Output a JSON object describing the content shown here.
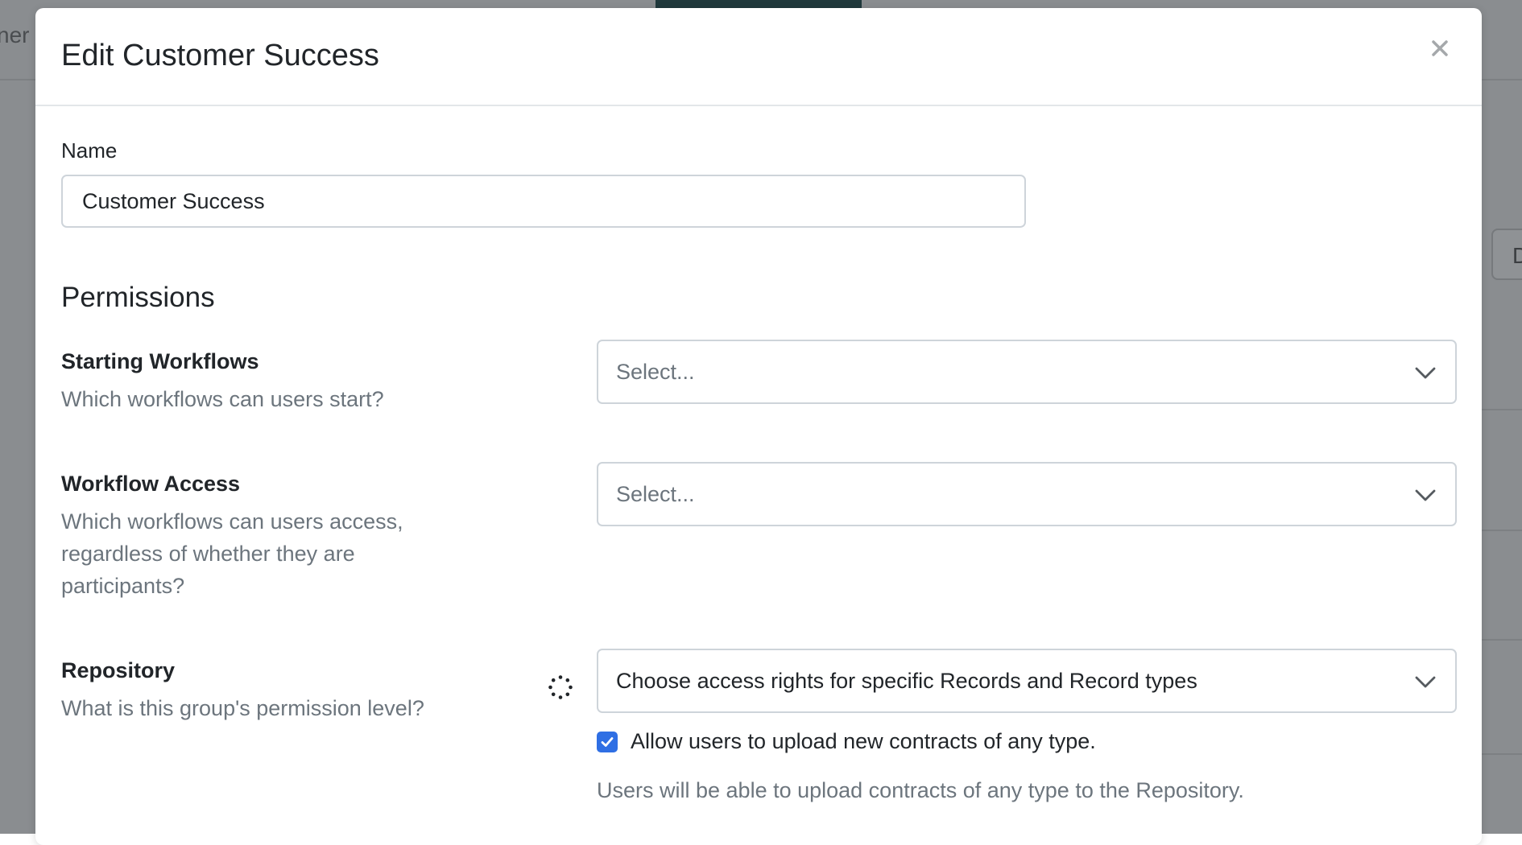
{
  "background": {
    "tab_fragment": "ner",
    "button_fragment": "D"
  },
  "modal": {
    "title": "Edit Customer Success",
    "close_icon": "close-icon"
  },
  "form": {
    "name_label": "Name",
    "name_value": "Customer Success"
  },
  "permissions": {
    "heading": "Permissions",
    "starting_workflows": {
      "label": "Starting Workflows",
      "description": "Which workflows can users start?",
      "select_placeholder": "Select..."
    },
    "workflow_access": {
      "label": "Workflow Access",
      "description": "Which workflows can users access, regardless of whether they are participants?",
      "select_placeholder": "Select..."
    },
    "repository": {
      "label": "Repository",
      "description": "What is this group's permission level?",
      "select_value": "Choose access rights for specific Records and Record types",
      "upload_checkbox_label": "Allow users to upload new contracts of any type.",
      "upload_checkbox_checked": true,
      "upload_help": "Users will be able to upload contracts of any type to the Repository."
    }
  },
  "colors": {
    "accent": "#2f6fe4",
    "muted_text": "#6c757d",
    "border": "#ced4da"
  }
}
